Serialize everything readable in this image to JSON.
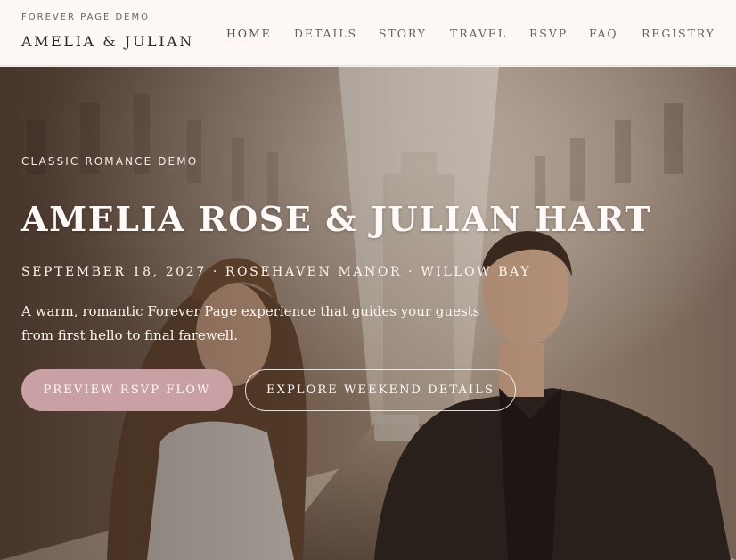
{
  "header": {
    "eyebrow": "FOREVER PAGE DEMO",
    "brand": "AMELIA & JULIAN"
  },
  "nav": {
    "items": [
      {
        "label": "HOME",
        "active": true
      },
      {
        "label": "DETAILS",
        "active": false
      },
      {
        "label": "STORY",
        "active": false
      },
      {
        "label": "TRAVEL",
        "active": false
      },
      {
        "label": "RSVP",
        "active": false
      },
      {
        "label": "FAQ",
        "active": false
      },
      {
        "label": "REGISTRY",
        "active": false
      }
    ]
  },
  "hero": {
    "eyebrow": "CLASSIC ROMANCE DEMO",
    "title": "AMELIA ROSE & JULIAN HART",
    "meta": "SEPTEMBER 18, 2027 · ROSEHAVEN MANOR · WILLOW BAY",
    "description_line1": "A warm, romantic Forever Page experience that guides your guests",
    "description_line2": "from first hello to final farewell.",
    "primary_button": "PREVIEW RSVP FLOW",
    "secondary_button": "EXPLORE WEEKEND DETAILS"
  },
  "colors": {
    "header_bg": "#fcf8f6",
    "primary_button_bg": "#c9a0a3",
    "text_dark": "#2f2624"
  }
}
